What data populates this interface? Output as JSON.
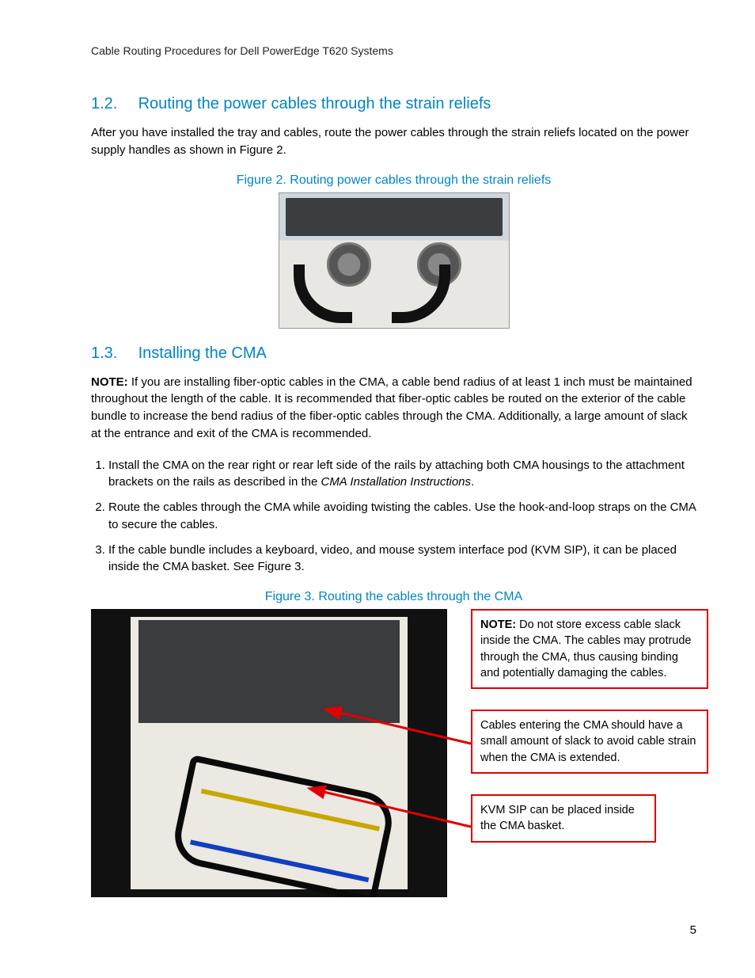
{
  "header": "Cable Routing Procedures for Dell PowerEdge T620 Systems",
  "section12": {
    "num": "1.2.",
    "title": "Routing the power cables through the strain reliefs",
    "para": "After you have installed the tray and cables, route the power cables through the strain reliefs located on the power supply handles as shown in Figure 2."
  },
  "figure2_caption": "Figure 2.    Routing power cables through the strain reliefs",
  "section13": {
    "num": "1.3.",
    "title": "Installing the CMA",
    "note_label": "NOTE:",
    "note_body": " If you are installing fiber-optic cables in the CMA, a cable bend radius of at least 1 inch must be maintained throughout the length of the cable.  It is recommended that fiber-optic cables be routed on the exterior of the cable bundle to increase the bend radius of the fiber-optic cables through the CMA.  Additionally, a large amount of slack at the entrance and exit of the CMA is recommended.",
    "steps": [
      {
        "pre": "Install the CMA on the rear right or rear left side of the rails by attaching both CMA housings to the attachment brackets on the rails as described in the ",
        "ital": "CMA Installation Instructions",
        "post": "."
      },
      {
        "pre": "Route the cables through the CMA while avoiding twisting the cables.  Use the hook-and-loop straps on the CMA to secure the cables.",
        "ital": "",
        "post": ""
      },
      {
        "pre": "If the cable bundle includes a keyboard, video, and mouse system interface pod (KVM SIP), it can be placed inside the CMA basket. See Figure 3.",
        "ital": "",
        "post": ""
      }
    ]
  },
  "figure3_caption": "Figure 3.    Routing the cables through the CMA",
  "callouts": {
    "c1_label": "NOTE:",
    "c1_body": "  Do not store excess cable slack inside the CMA.  The cables may protrude through the CMA, thus causing binding and potentially damaging the cables.",
    "c2": "Cables entering the CMA should have a small amount of slack to avoid cable strain when the CMA is extended.",
    "c3": "KVM SIP can be placed inside the CMA basket."
  },
  "page_number": "5"
}
